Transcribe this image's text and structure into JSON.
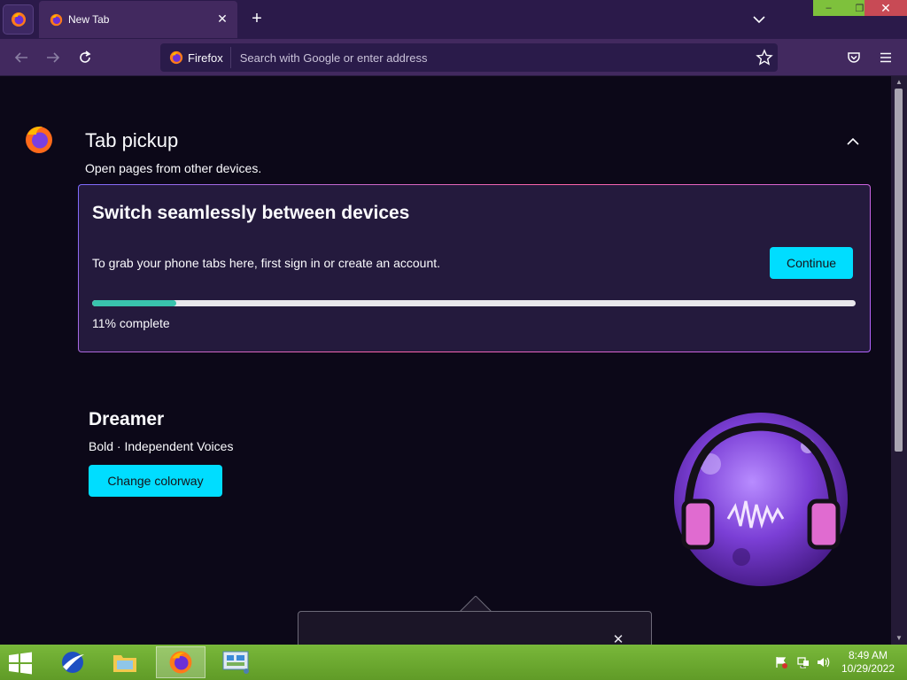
{
  "browser": {
    "tab": {
      "title": "New Tab",
      "icon": "firefox-icon"
    },
    "new_tab_symbol": "+",
    "close_symbol": "✕",
    "window_controls": {
      "minimize": "–",
      "maximize": "❐",
      "close": "✕"
    }
  },
  "navbar": {
    "identity_label": "Firefox",
    "search_placeholder": "Search with Google or enter address",
    "search_value": ""
  },
  "tab_pickup": {
    "heading": "Tab pickup",
    "subheading": "Open pages from other devices.",
    "card": {
      "title": "Switch seamlessly between devices",
      "description": "To grab your phone tabs here, first sign in or create an account.",
      "button": "Continue",
      "progress_fraction": 0.11,
      "progress_label": "11% complete"
    }
  },
  "colorway": {
    "title": "Dreamer",
    "subtitle": "Bold · Independent Voices",
    "button": "Change colorway"
  },
  "taskbar": {
    "time": "8:49 AM",
    "date": "10/29/2022"
  },
  "colors": {
    "accent": "#00ddff",
    "progress": "#39c3ad",
    "toolbar": "#42295f",
    "tabstrip": "#2b1a4a",
    "content_bg": "#0c0818",
    "taskbar": "#6aa82e"
  }
}
